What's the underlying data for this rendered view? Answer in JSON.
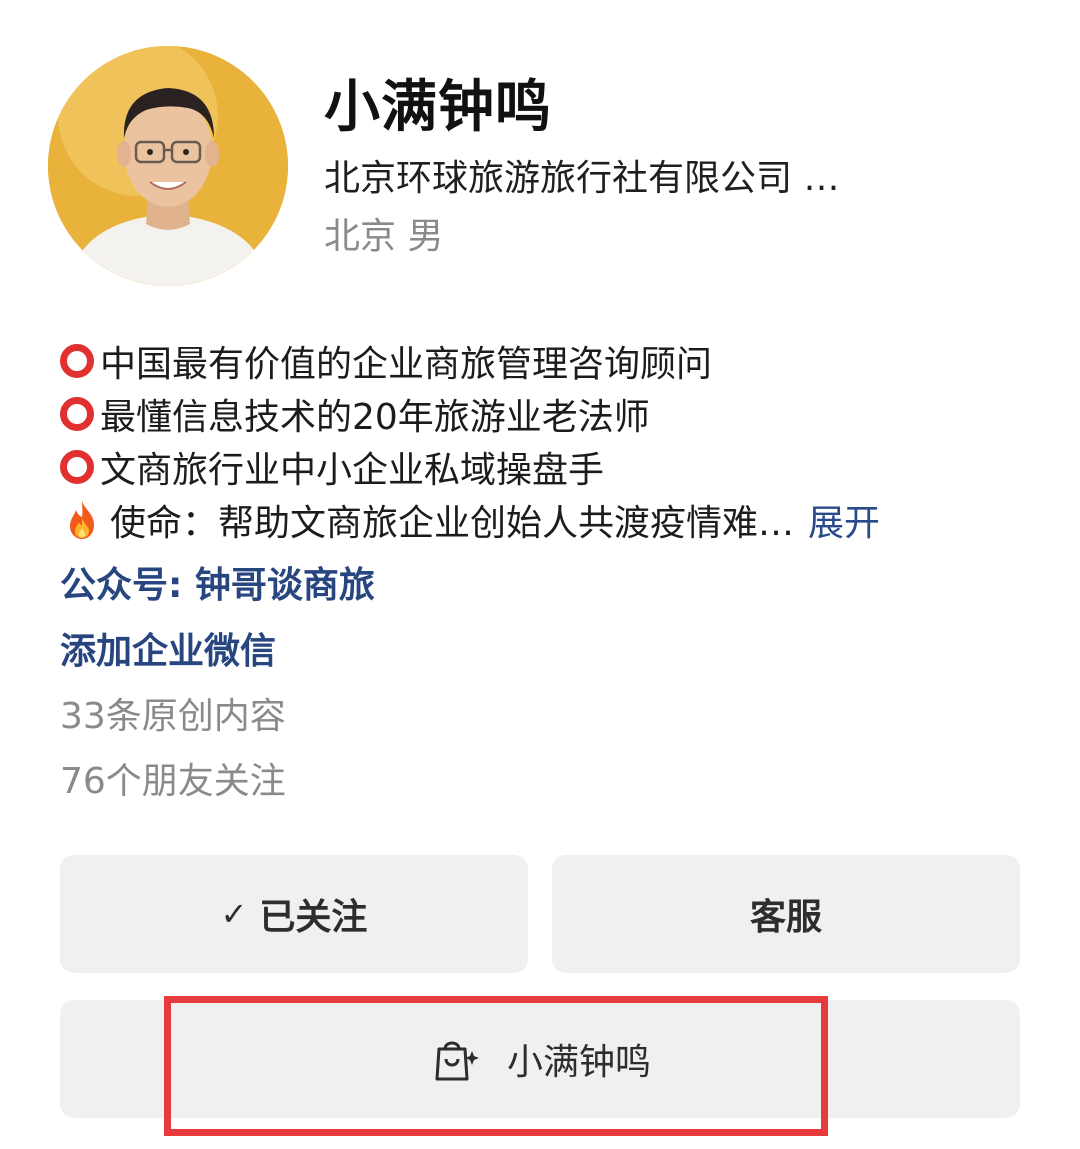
{
  "profile": {
    "name": "小满钟鸣",
    "company": "北京环球旅游旅行社有限公司 …",
    "location": "北京 男"
  },
  "bio": {
    "lines": [
      {
        "icon": "red-circle-icon",
        "text": "中国最有价值的企业商旅管理咨询顾问"
      },
      {
        "icon": "red-circle-icon",
        "text": "最懂信息技术的20年旅游业老法师"
      },
      {
        "icon": "red-circle-icon",
        "text": "文商旅行业中小企业私域操盘手"
      },
      {
        "icon": "fire-icon",
        "text": "使命：帮助文商旅企业创始人共渡疫情难…"
      }
    ],
    "expand_label": "展开"
  },
  "links": {
    "official_account": "公众号: 钟哥谈商旅",
    "add_wechat": "添加企业微信"
  },
  "stats": {
    "original_content": "33条原创内容",
    "friends_following": "76个朋友关注"
  },
  "actions": {
    "follow_check": "✓",
    "follow_label": "已关注",
    "service_label": "客服",
    "shop_label": "小满钟鸣",
    "shop_icon": "shopping-bag-sparkle-icon"
  },
  "colors": {
    "link": "#27457f",
    "ring": "#e0302f",
    "highlight_border": "#e63a3d",
    "button_bg": "#f0f0f0"
  }
}
